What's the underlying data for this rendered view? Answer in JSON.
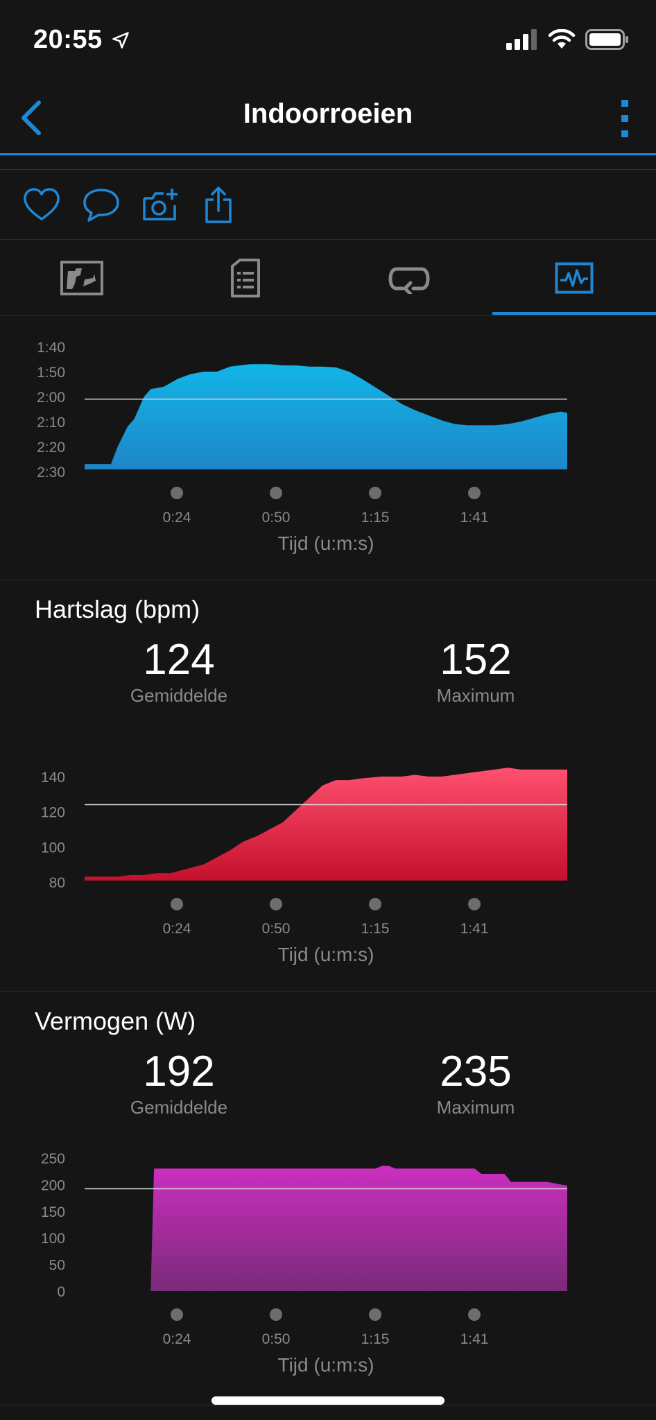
{
  "status_bar": {
    "time": "20:55"
  },
  "header": {
    "title": "Indoorroeien"
  },
  "icons": {
    "back": "chevron-left-icon",
    "more": "more-vertical-icon",
    "like": "heart-icon",
    "comment": "comment-icon",
    "photo": "camera-add-icon",
    "share": "share-icon",
    "tab_overview": "map-icon",
    "tab_details": "document-list-icon",
    "tab_laps": "laps-icon",
    "tab_charts": "chart-icon"
  },
  "colors": {
    "accent": "#1e88d6",
    "pace": "#1aa8e0",
    "heart_rate": "#e8264a",
    "power": "#c42fb8"
  },
  "charts": {
    "pace": {
      "x_axis_title": "Tijd (u:m:s)",
      "x_ticks": [
        "0:24",
        "0:50",
        "1:15",
        "1:41"
      ],
      "y_ticks": [
        "1:40",
        "1:50",
        "2:00",
        "2:10",
        "2:20",
        "2:30"
      ]
    },
    "heart_rate": {
      "title": "Hartslag (bpm)",
      "average_value": "124",
      "average_label": "Gemiddelde",
      "max_value": "152",
      "max_label": "Maximum",
      "x_axis_title": "Tijd (u:m:s)",
      "x_ticks": [
        "0:24",
        "0:50",
        "1:15",
        "1:41"
      ],
      "y_ticks": [
        "140",
        "120",
        "100",
        "80"
      ]
    },
    "power": {
      "title": "Vermogen (W)",
      "average_value": "192",
      "average_label": "Gemiddelde",
      "max_value": "235",
      "max_label": "Maximum",
      "x_axis_title": "Tijd (u:m:s)",
      "x_ticks": [
        "0:24",
        "0:50",
        "1:15",
        "1:41"
      ],
      "y_ticks": [
        "250",
        "200",
        "150",
        "100",
        "50",
        "0"
      ]
    }
  },
  "chart_data": [
    {
      "type": "area",
      "x_unit": "seconds",
      "y_unit": "seconds per 500m",
      "x": [
        0,
        8,
        10,
        13,
        15,
        18,
        20,
        24,
        28,
        32,
        36,
        40,
        44,
        50,
        56,
        60,
        64,
        68,
        72,
        76,
        80,
        84,
        90,
        96,
        100,
        104,
        108,
        112,
        116,
        120,
        124,
        128,
        132,
        136,
        140,
        144,
        146
      ],
      "y": [
        147,
        147,
        140,
        132,
        129,
        120,
        117,
        116,
        113,
        111,
        110,
        110,
        108,
        107,
        107,
        107.5,
        107.5,
        108,
        108,
        108.3,
        110,
        113,
        118,
        123,
        125.5,
        127.5,
        129.5,
        131,
        131.5,
        131.5,
        131.5,
        131,
        130,
        128.5,
        127,
        126,
        126.5
      ],
      "average": 121,
      "xlabel": "Tijd (u:m:s)",
      "y_tick_labels": [
        "1:40",
        "1:50",
        "2:00",
        "2:10",
        "2:20",
        "2:30"
      ],
      "y_range_inverted": [
        100,
        150
      ],
      "grid": false
    },
    {
      "type": "area",
      "x_unit": "seconds",
      "x": [
        0,
        6,
        10,
        14,
        18,
        22,
        26,
        30,
        34,
        36,
        40,
        44,
        48,
        52,
        56,
        60,
        64,
        68,
        72,
        76,
        80,
        84,
        90,
        96,
        100,
        104,
        108,
        112,
        116,
        120,
        124,
        128,
        132,
        136,
        140,
        144,
        146
      ],
      "y": [
        83,
        83,
        83,
        84,
        84,
        85,
        85,
        87,
        89,
        90,
        94,
        98,
        103,
        106,
        110,
        114,
        121,
        128,
        135,
        138,
        138,
        139,
        140,
        140,
        141,
        140,
        140,
        141,
        142,
        143,
        144,
        145,
        144,
        144,
        144,
        144,
        144
      ],
      "average": 124,
      "max": 152,
      "title": "Hartslag (bpm)",
      "xlabel": "Tijd (u:m:s)",
      "ylim": [
        80,
        152
      ],
      "grid": false
    },
    {
      "type": "area",
      "x_unit": "seconds",
      "x": [
        0,
        20,
        21,
        40,
        60,
        80,
        88,
        90,
        92,
        94,
        96,
        100,
        110,
        116,
        118,
        120,
        127,
        129,
        132,
        140,
        144,
        146
      ],
      "y": [
        0,
        0,
        230,
        230,
        230,
        230,
        230,
        235,
        235,
        230,
        230,
        230,
        230,
        230,
        230,
        220,
        220,
        205,
        205,
        205,
        200,
        198
      ],
      "average": 192,
      "max": 235,
      "title": "Vermogen (W)",
      "xlabel": "Tijd (u:m:s)",
      "ylim": [
        0,
        250
      ],
      "grid": false
    }
  ]
}
